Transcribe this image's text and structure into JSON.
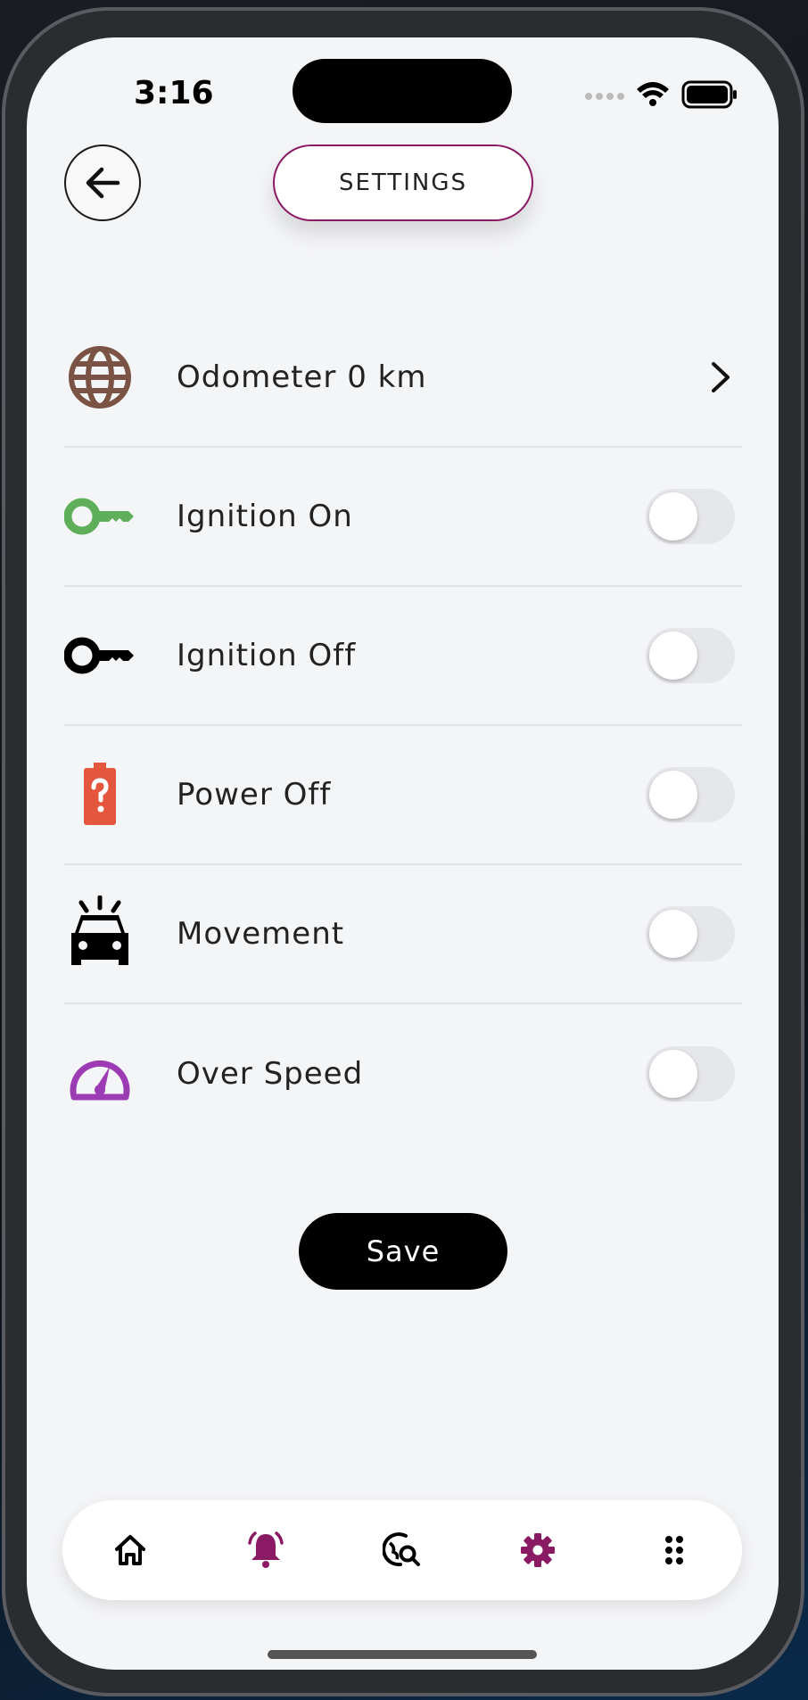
{
  "status_bar": {
    "time": "3:16"
  },
  "header": {
    "title": "SETTINGS"
  },
  "settings": [
    {
      "label": "Odometer 0 km",
      "icon": "globe-icon",
      "icon_color": "#7b5344",
      "control": "chevron"
    },
    {
      "label": "Ignition On",
      "icon": "key-icon",
      "icon_color": "#5fae5a",
      "control": "toggle",
      "enabled": false
    },
    {
      "label": "Ignition Off",
      "icon": "key-icon",
      "icon_color": "#000000",
      "control": "toggle",
      "enabled": false
    },
    {
      "label": "Power Off",
      "icon": "battery-unknown-icon",
      "icon_color": "#e5563f",
      "control": "toggle",
      "enabled": false
    },
    {
      "label": "Movement",
      "icon": "car-alert-icon",
      "icon_color": "#000000",
      "control": "toggle",
      "enabled": false
    },
    {
      "label": "Over Speed",
      "icon": "speedometer-icon",
      "icon_color": "#9b3cb5",
      "control": "toggle",
      "enabled": false
    }
  ],
  "save_button": {
    "label": "Save"
  },
  "bottom_nav": [
    {
      "icon": "home-icon",
      "color": "#000000",
      "active": false
    },
    {
      "icon": "bell-ringing-icon",
      "color": "#8a1a63",
      "active": false
    },
    {
      "icon": "globe-search-icon",
      "color": "#000000",
      "active": false
    },
    {
      "icon": "gear-icon",
      "color": "#8a1a63",
      "active": true
    },
    {
      "icon": "grid-dots-icon",
      "color": "#000000",
      "active": false
    }
  ],
  "colors": {
    "accent": "#8a1a63",
    "background": "#f4f5f7"
  }
}
